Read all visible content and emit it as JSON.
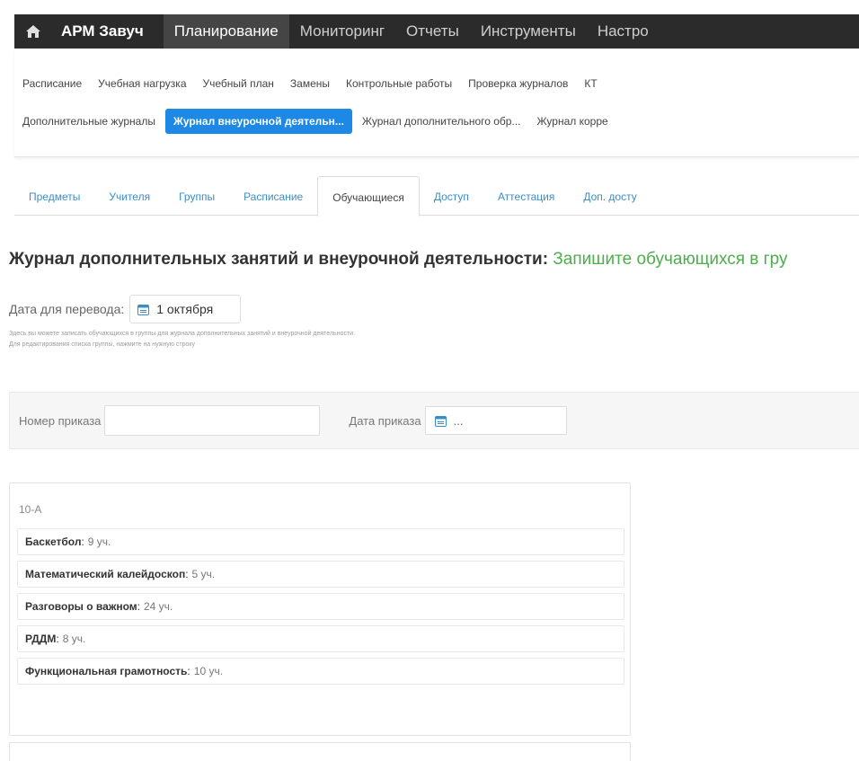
{
  "app": {
    "brand": "АРМ Завуч",
    "top_nav": [
      "Планирование",
      "Мониторинг",
      "Отчеты",
      "Инструменты",
      "Настро"
    ],
    "active_top_nav": "Планирование"
  },
  "submenu": {
    "row1": [
      "Расписание",
      "Учебная нагрузка",
      "Учебный план",
      "Замены",
      "Контрольные работы",
      "Проверка журналов",
      "КТ"
    ],
    "row2": [
      "Дополнительные журналы",
      "Журнал внеурочной деятельн...",
      "Журнал дополнительного обр...",
      "Журнал корре"
    ],
    "active": "Журнал внеурочной деятельн..."
  },
  "tabs": {
    "items": [
      "Предметы",
      "Учителя",
      "Группы",
      "Расписание",
      "Обучающиеся",
      "Доступ",
      "Аттестация",
      "Доп. досту"
    ],
    "active": "Обучающиеся"
  },
  "heading": {
    "title": "Журнал дополнительных занятий и внеурочной деятельности:",
    "highlight": " Запишите обучающихся в гру"
  },
  "transfer": {
    "label": "Дата для перевода:",
    "date": "1 октября",
    "hint_line1": "Здесь вы можете записать обучающихся в группы для журнала дополнительных занятий и внеурочной деятельности.",
    "hint_line2": "Для редактирования списка группы, нажмите на нужную строку"
  },
  "order": {
    "number_label": "Номер приказа",
    "number_value": "",
    "date_label": "Дата приказа",
    "date_value": "..."
  },
  "group": {
    "title": "10-А",
    "items": [
      {
        "name": "Баскетбол",
        "count": "9 уч."
      },
      {
        "name": "Математический калейдоскоп",
        "count": "5 уч."
      },
      {
        "name": "Разговоры о важном",
        "count": "24 уч."
      },
      {
        "name": "РДДМ",
        "count": "8 уч."
      },
      {
        "name": "Функциональная грамотность",
        "count": "10 уч."
      }
    ]
  },
  "colors": {
    "navbar": "#2b2b2b",
    "active_submenu": "#1e88e5",
    "tab_link": "#3a8ec7",
    "highlight_green": "#4cae4c"
  }
}
